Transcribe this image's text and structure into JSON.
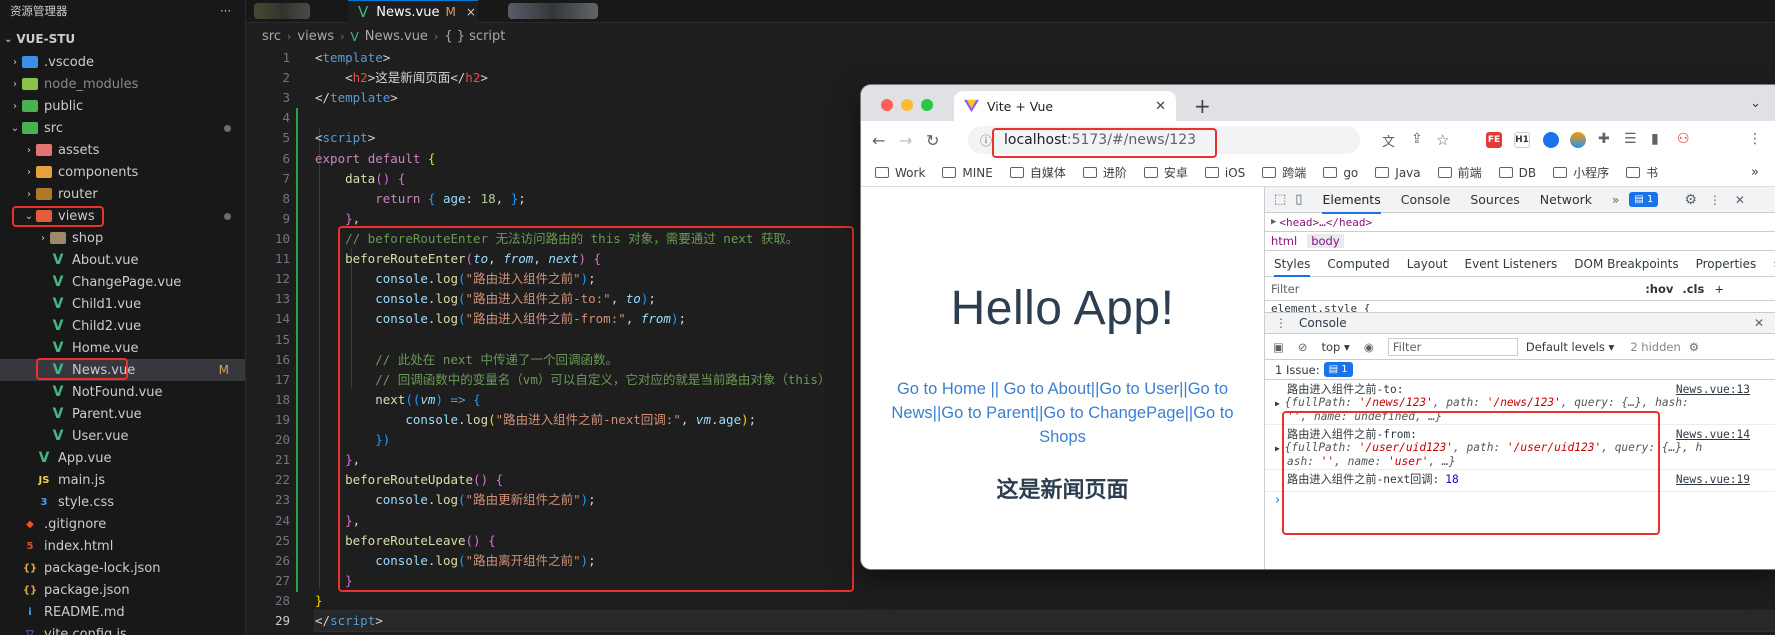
{
  "explorer": {
    "title": "资源管理器",
    "more": "···",
    "project": "VUE-STU",
    "items": [
      {
        "label": ".vscode",
        "type": "folder",
        "icon": "vscode-folder-icon",
        "color": "#3b8eea",
        "depth": 0,
        "open": false
      },
      {
        "label": "node_modules",
        "type": "folder",
        "icon": "node-folder-icon",
        "color": "#8bc34a",
        "depth": 0,
        "open": false,
        "dim": true
      },
      {
        "label": "public",
        "type": "folder",
        "icon": "public-folder-icon",
        "color": "#4caf50",
        "depth": 0,
        "open": false
      },
      {
        "label": "src",
        "type": "folder",
        "icon": "src-folder-icon",
        "color": "#4caf50",
        "depth": 0,
        "open": true,
        "dot": true
      },
      {
        "label": "assets",
        "type": "folder",
        "icon": "assets-folder-icon",
        "color": "#e57373",
        "depth": 1,
        "open": false
      },
      {
        "label": "components",
        "type": "folder",
        "icon": "components-folder-icon",
        "color": "#e5a23b",
        "depth": 1,
        "open": false
      },
      {
        "label": "router",
        "type": "folder",
        "icon": "router-folder-icon",
        "color": "#b0792a",
        "depth": 1,
        "open": false
      },
      {
        "label": "views",
        "type": "folder",
        "icon": "views-folder-icon",
        "color": "#e55e3b",
        "depth": 1,
        "open": true,
        "dot": true,
        "boxed": true
      },
      {
        "label": "shop",
        "type": "folder",
        "icon": "folder-icon",
        "color": "#9e8a6a",
        "depth": 2,
        "open": false
      },
      {
        "label": "About.vue",
        "type": "vue",
        "depth": 2
      },
      {
        "label": "ChangePage.vue",
        "type": "vue",
        "depth": 2
      },
      {
        "label": "Child1.vue",
        "type": "vue",
        "depth": 2
      },
      {
        "label": "Child2.vue",
        "type": "vue",
        "depth": 2
      },
      {
        "label": "Home.vue",
        "type": "vue",
        "depth": 2
      },
      {
        "label": "News.vue",
        "type": "vue",
        "depth": 2,
        "selected": true,
        "badge": "M",
        "boxed": true
      },
      {
        "label": "NotFound.vue",
        "type": "vue",
        "depth": 2
      },
      {
        "label": "Parent.vue",
        "type": "vue",
        "depth": 2
      },
      {
        "label": "User.vue",
        "type": "vue",
        "depth": 2
      },
      {
        "label": "App.vue",
        "type": "vue",
        "depth": 1
      },
      {
        "label": "main.js",
        "type": "js",
        "depth": 1
      },
      {
        "label": "style.css",
        "type": "css",
        "depth": 1
      },
      {
        "label": ".gitignore",
        "type": "git",
        "depth": 0
      },
      {
        "label": "index.html",
        "type": "html",
        "depth": 0
      },
      {
        "label": "package-lock.json",
        "type": "json",
        "depth": 0
      },
      {
        "label": "package.json",
        "type": "json",
        "depth": 0
      },
      {
        "label": "README.md",
        "type": "md",
        "depth": 0
      },
      {
        "label": "vite.config.js",
        "type": "vite",
        "depth": 0
      }
    ]
  },
  "editor": {
    "tab_label": "News.vue",
    "tab_badge": "M",
    "tab_close": "×",
    "breadcrumb": [
      "src",
      "views",
      "News.vue",
      "{ } script"
    ],
    "current_line": 29,
    "lines": [
      [
        [
          "br",
          "<"
        ],
        [
          "tagname",
          "template"
        ],
        [
          "br",
          ">"
        ]
      ],
      [
        [
          "txt",
          "    "
        ],
        [
          "br",
          "<"
        ],
        [
          "tag",
          "h2"
        ],
        [
          "br",
          ">"
        ],
        [
          "txt",
          "这是新闻页面</"
        ],
        [
          "tag",
          "h2"
        ],
        [
          "br",
          ">"
        ]
      ],
      [
        [
          "br",
          "</"
        ],
        [
          "tagname",
          "template"
        ],
        [
          "br",
          ">"
        ]
      ],
      [],
      [
        [
          "br",
          "<"
        ],
        [
          "tagname",
          "script"
        ],
        [
          "br",
          ">"
        ]
      ],
      [
        [
          "kw",
          "export"
        ],
        [
          "txt",
          " "
        ],
        [
          "kw",
          "default"
        ],
        [
          "txt",
          " "
        ],
        [
          "gold",
          "{"
        ]
      ],
      [
        [
          "txt",
          "    "
        ],
        [
          "fn",
          "data"
        ],
        [
          "pink",
          "()"
        ],
        [
          "txt",
          " "
        ],
        [
          "pink",
          "{"
        ]
      ],
      [
        [
          "txt",
          "        "
        ],
        [
          "kw",
          "return"
        ],
        [
          "txt",
          " "
        ],
        [
          "blue2",
          "{"
        ],
        [
          "txt",
          " "
        ],
        [
          "prop",
          "age"
        ],
        [
          "txt",
          ": "
        ],
        [
          "num",
          "18"
        ],
        [
          "txt",
          ", "
        ],
        [
          "blue2",
          "}"
        ],
        [
          "txt",
          ";"
        ]
      ],
      [
        [
          "txt",
          "    "
        ],
        [
          "pink",
          "}"
        ],
        [
          "txt",
          ","
        ]
      ],
      [
        [
          "txt",
          "    "
        ],
        [
          "cmt",
          "// beforeRouteEnter 无法访问路由的 this 对象，需要通过 next 获取。"
        ]
      ],
      [
        [
          "txt",
          "    "
        ],
        [
          "fn",
          "beforeRouteEnter"
        ],
        [
          "pink",
          "("
        ],
        [
          "prm",
          "to"
        ],
        [
          "txt",
          ", "
        ],
        [
          "prm",
          "from"
        ],
        [
          "txt",
          ", "
        ],
        [
          "prm",
          "next"
        ],
        [
          "pink",
          ")"
        ],
        [
          "txt",
          " "
        ],
        [
          "pink",
          "{"
        ]
      ],
      [
        [
          "txt",
          "        "
        ],
        [
          "prop",
          "console"
        ],
        [
          "txt",
          "."
        ],
        [
          "fn",
          "log"
        ],
        [
          "blue2",
          "("
        ],
        [
          "str",
          "\"路由进入组件之前\""
        ],
        [
          "blue2",
          ")"
        ],
        [
          "txt",
          ";"
        ]
      ],
      [
        [
          "txt",
          "        "
        ],
        [
          "prop",
          "console"
        ],
        [
          "txt",
          "."
        ],
        [
          "fn",
          "log"
        ],
        [
          "blue2",
          "("
        ],
        [
          "str",
          "\"路由进入组件之前-to:\""
        ],
        [
          "txt",
          ", "
        ],
        [
          "prm",
          "to"
        ],
        [
          "blue2",
          ")"
        ],
        [
          "txt",
          ";"
        ]
      ],
      [
        [
          "txt",
          "        "
        ],
        [
          "prop",
          "console"
        ],
        [
          "txt",
          "."
        ],
        [
          "fn",
          "log"
        ],
        [
          "blue2",
          "("
        ],
        [
          "str",
          "\"路由进入组件之前-from:\""
        ],
        [
          "txt",
          ", "
        ],
        [
          "prm",
          "from"
        ],
        [
          "blue2",
          ")"
        ],
        [
          "txt",
          ";"
        ]
      ],
      [],
      [
        [
          "txt",
          "        "
        ],
        [
          "cmt",
          "// 此处在 next 中传递了一个回调函数。"
        ]
      ],
      [
        [
          "txt",
          "        "
        ],
        [
          "cmt",
          "// 回调函数中的变量名（vm）可以自定义，它对应的就是当前路由对象（this）"
        ]
      ],
      [
        [
          "txt",
          "        "
        ],
        [
          "fn",
          "next"
        ],
        [
          "blue2",
          "(("
        ],
        [
          "prm",
          "vm"
        ],
        [
          "blue2",
          ")"
        ],
        [
          "txt",
          " "
        ],
        [
          "kw2",
          "=>"
        ],
        [
          "txt",
          " "
        ],
        [
          "blue2",
          "{"
        ]
      ],
      [
        [
          "txt",
          "            "
        ],
        [
          "prop",
          "console"
        ],
        [
          "txt",
          "."
        ],
        [
          "fn",
          "log"
        ],
        [
          "gold",
          "("
        ],
        [
          "str",
          "\"路由进入组件之前-next回调:\""
        ],
        [
          "txt",
          ", "
        ],
        [
          "prm",
          "vm"
        ],
        [
          "txt",
          "."
        ],
        [
          "prop",
          "age"
        ],
        [
          "gold",
          ")"
        ],
        [
          "txt",
          ";"
        ]
      ],
      [
        [
          "txt",
          "        "
        ],
        [
          "blue2",
          "})"
        ]
      ],
      [
        [
          "txt",
          "    "
        ],
        [
          "pink",
          "}"
        ],
        [
          "txt",
          ","
        ]
      ],
      [
        [
          "txt",
          "    "
        ],
        [
          "fn",
          "beforeRouteUpdate"
        ],
        [
          "pink",
          "()"
        ],
        [
          "txt",
          " "
        ],
        [
          "pink",
          "{"
        ]
      ],
      [
        [
          "txt",
          "        "
        ],
        [
          "prop",
          "console"
        ],
        [
          "txt",
          "."
        ],
        [
          "fn",
          "log"
        ],
        [
          "blue2",
          "("
        ],
        [
          "str",
          "\"路由更新组件之前\""
        ],
        [
          "blue2",
          ")"
        ],
        [
          "txt",
          ";"
        ]
      ],
      [
        [
          "txt",
          "    "
        ],
        [
          "pink",
          "}"
        ],
        [
          "txt",
          ","
        ]
      ],
      [
        [
          "txt",
          "    "
        ],
        [
          "fn",
          "beforeRouteLeave"
        ],
        [
          "pink",
          "()"
        ],
        [
          "txt",
          " "
        ],
        [
          "pink",
          "{"
        ]
      ],
      [
        [
          "txt",
          "        "
        ],
        [
          "prop",
          "console"
        ],
        [
          "txt",
          "."
        ],
        [
          "fn",
          "log"
        ],
        [
          "blue2",
          "("
        ],
        [
          "str",
          "\"路由离开组件之前\""
        ],
        [
          "blue2",
          ")"
        ],
        [
          "txt",
          ";"
        ]
      ],
      [
        [
          "txt",
          "    "
        ],
        [
          "pink",
          "}"
        ]
      ],
      [
        [
          "gold",
          "}"
        ]
      ],
      [
        [
          "br",
          "</"
        ],
        [
          "tagname",
          "script"
        ],
        [
          "br",
          ">"
        ]
      ]
    ]
  },
  "browser": {
    "tab_title": "Vite + Vue",
    "tab_close": "✕",
    "new_tab": "+",
    "url_host": "localhost",
    "url_path": ":5173/#/news/123",
    "bookmarks": [
      "Work",
      "MINE",
      "自媒体",
      "进阶",
      "安卓",
      "iOS",
      "跨端",
      "go",
      "Java",
      "前端",
      "DB",
      "小程序",
      "书"
    ],
    "bookmarks_more": "»",
    "extensions": [
      "FE",
      "H1"
    ],
    "page": {
      "heading": "Hello App!",
      "links": "Go to Home || Go to About||Go to User||Go to News||Go to Parent||Go to ChangePage||Go to Shops",
      "content": "这是新闻页面"
    }
  },
  "devtools": {
    "tabs": [
      "Elements",
      "Console",
      "Sources",
      "Network"
    ],
    "tabs_more": "»",
    "issues_count": "1",
    "dom_head": "<head>…</head>",
    "crumbs": [
      "html",
      "body"
    ],
    "style_tabs": [
      "Styles",
      "Computed",
      "Layout",
      "Event Listeners",
      "DOM Breakpoints",
      "Properties"
    ],
    "filter_placeholder": "Filter",
    "hov": ":hov",
    "cls": ".cls",
    "new_rule": "+",
    "element_style": "element.style {",
    "console_title": "Console",
    "context": "top",
    "console_filter": "Filter",
    "levels": "Default levels",
    "hidden": "2 hidden",
    "issue_label": "1 Issue:",
    "issue_count": "1",
    "entries": [
      {
        "label": "路由进入组件之前-to:",
        "source": "News.vue:13",
        "line1": [
          [
            "ck",
            "{fullPath: "
          ],
          [
            "cstr",
            "'/news/123'"
          ],
          [
            "ck",
            ", path: "
          ],
          [
            "cstr",
            "'/news/123'"
          ],
          [
            "ck",
            ", query: {…}, hash:"
          ]
        ],
        "line2": [
          [
            "cstr",
            "''"
          ],
          [
            "ck",
            ", name: undefined, …}"
          ]
        ]
      },
      {
        "label": "路由进入组件之前-from:",
        "source": "News.vue:14",
        "line1": [
          [
            "ck",
            "{fullPath: "
          ],
          [
            "cstr",
            "'/user/uid123'"
          ],
          [
            "ck",
            ", path: "
          ],
          [
            "cstr",
            "'/user/uid123'"
          ],
          [
            "ck",
            ", query: {…}, h"
          ]
        ],
        "line2": [
          [
            "ck",
            "ash: "
          ],
          [
            "cstr",
            "''"
          ],
          [
            "ck",
            ", name: "
          ],
          [
            "cstr",
            "'user'"
          ],
          [
            "ck",
            ", …}"
          ]
        ]
      },
      {
        "label": "路由进入组件之前-next回调:",
        "value": "18",
        "source": "News.vue:19"
      }
    ],
    "prompt": "›"
  }
}
